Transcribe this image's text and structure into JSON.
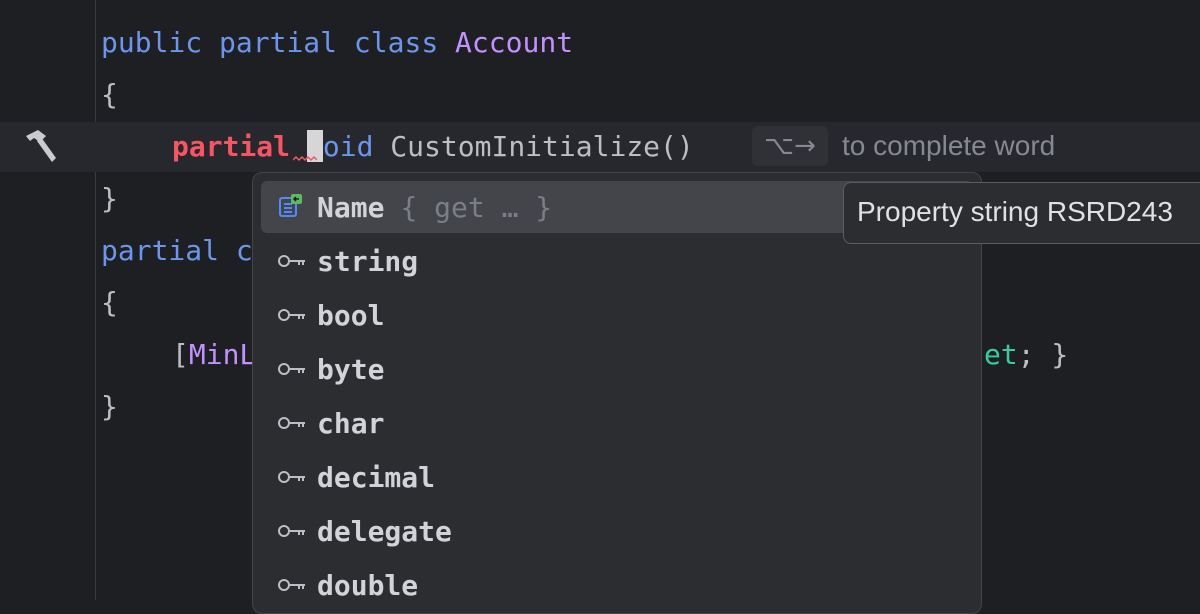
{
  "editor": {
    "line1": {
      "kw1": "public",
      "kw2": "partial",
      "kw3": "class",
      "cls": "Account"
    },
    "line2": "{",
    "line3": {
      "bad": "partial",
      "rest_dim": "oid",
      "rest": " CustomInitialize()"
    },
    "line4": "}",
    "line5": {
      "kw": "partial",
      "tail": " c"
    },
    "line6": "{",
    "line7": {
      "open": "[",
      "attr": "MinL",
      "green": "et",
      "close": "; }"
    },
    "line8": "}"
  },
  "hint": {
    "keys": "⌥→",
    "text": "to complete word"
  },
  "completion": {
    "items": [
      {
        "label": "Name",
        "tail": "{ get … }",
        "icon": "property-icon"
      },
      {
        "label": "string",
        "icon": "keyword-icon"
      },
      {
        "label": "bool",
        "icon": "keyword-icon"
      },
      {
        "label": "byte",
        "icon": "keyword-icon"
      },
      {
        "label": "char",
        "icon": "keyword-icon"
      },
      {
        "label": "decimal",
        "icon": "keyword-icon"
      },
      {
        "label": "delegate",
        "icon": "keyword-icon"
      },
      {
        "label": "double",
        "icon": "keyword-icon"
      }
    ]
  },
  "tooltip": {
    "text": "Property string RSRD243"
  },
  "colors": {
    "background": "#1e1f22",
    "keyword": "#6c95eb",
    "class_name": "#c191ff",
    "error": "#f75464",
    "selection": "#43454a"
  }
}
